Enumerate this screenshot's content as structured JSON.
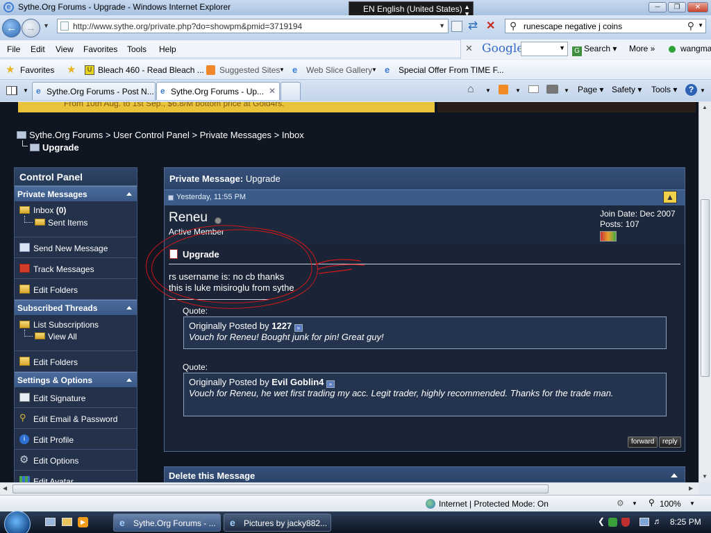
{
  "window": {
    "title": "Sythe.Org Forums - Upgrade - Windows Internet Explorer",
    "language": "EN English (United States)"
  },
  "browser": {
    "url": "http://www.sythe.org/private.php?do=showpm&pmid=3719194",
    "search_value": "runescape negative j coins",
    "menu": [
      "File",
      "Edit",
      "View",
      "Favorites",
      "Tools",
      "Help"
    ],
    "google": {
      "logo": "Google",
      "search_label": "Search",
      "more_label": "More",
      "user": "wangma"
    },
    "favorites_label": "Favorites",
    "favorites": [
      "Bleach 460 - Read Bleach ...",
      "Suggested Sites",
      "Web Slice Gallery",
      "Special Offer From TIME F..."
    ],
    "tabs": [
      "Sythe.Org Forums - Post N...",
      "Sythe.Org Forums - Up..."
    ],
    "tools": [
      "Page",
      "Safety",
      "Tools"
    ]
  },
  "page": {
    "banner_text": "From 10th Aug. to 1st Sep., $6.8/M bottom price at Gold4rs.",
    "breadcrumb": [
      "Sythe.Org Forums",
      "User Control Panel",
      "Private Messages",
      "Inbox"
    ],
    "breadcrumb_sep": ">",
    "current": "Upgrade",
    "sidebar": {
      "title": "Control Panel",
      "sections": [
        {
          "title": "Private Messages",
          "items": [
            "Inbox (0)",
            "Sent Items",
            "Send New Message",
            "Track Messages",
            "Edit Folders"
          ]
        },
        {
          "title": "Subscribed Threads",
          "items": [
            "List Subscriptions",
            "View All",
            "Edit Folders"
          ]
        },
        {
          "title": "Settings & Options",
          "items": [
            "Edit Signature",
            "Edit Email & Password",
            "Edit Profile",
            "Edit Options",
            "Edit Avatar"
          ]
        }
      ],
      "inbox_label": "Inbox",
      "inbox_count": "(0)"
    },
    "message": {
      "header_prefix": "Private Message:",
      "header_title": "Upgrade",
      "date": "Yesterday, 11:55 PM",
      "username": "Reneu",
      "usertitle": "Active Member",
      "join_date": "Join Date: Dec 2007",
      "posts": "Posts: 107",
      "subject": "Upgrade",
      "body_line1": "rs username is: no cb thanks",
      "body_line2": "this is luke misiroglu from sythe",
      "quote_label": "Quote:",
      "quotes": [
        {
          "prefix": "Originally Posted by",
          "author": "1227",
          "text": "Vouch for Reneu! Bought junk for pin! Great guy!"
        },
        {
          "prefix": "Originally Posted by",
          "author": "Evil Goblin4",
          "text": "Vouch for Reneu, he wet first trading my acc. Legit trader, highly recommended. Thanks for the trade man."
        }
      ],
      "forward_label": "forward",
      "reply_label": "reply"
    },
    "delete_title": "Delete this Message"
  },
  "statusbar": {
    "zone": "Internet | Protected Mode: On",
    "zoom": "100%"
  },
  "taskbar": {
    "items": [
      "Sythe.Org Forums - ...",
      "Pictures by jacky882..."
    ],
    "clock": "8:25 PM"
  },
  "colors": {
    "page_bg": "#0f1621",
    "panel_header": "#2b4368",
    "annotation": "#d01818"
  }
}
